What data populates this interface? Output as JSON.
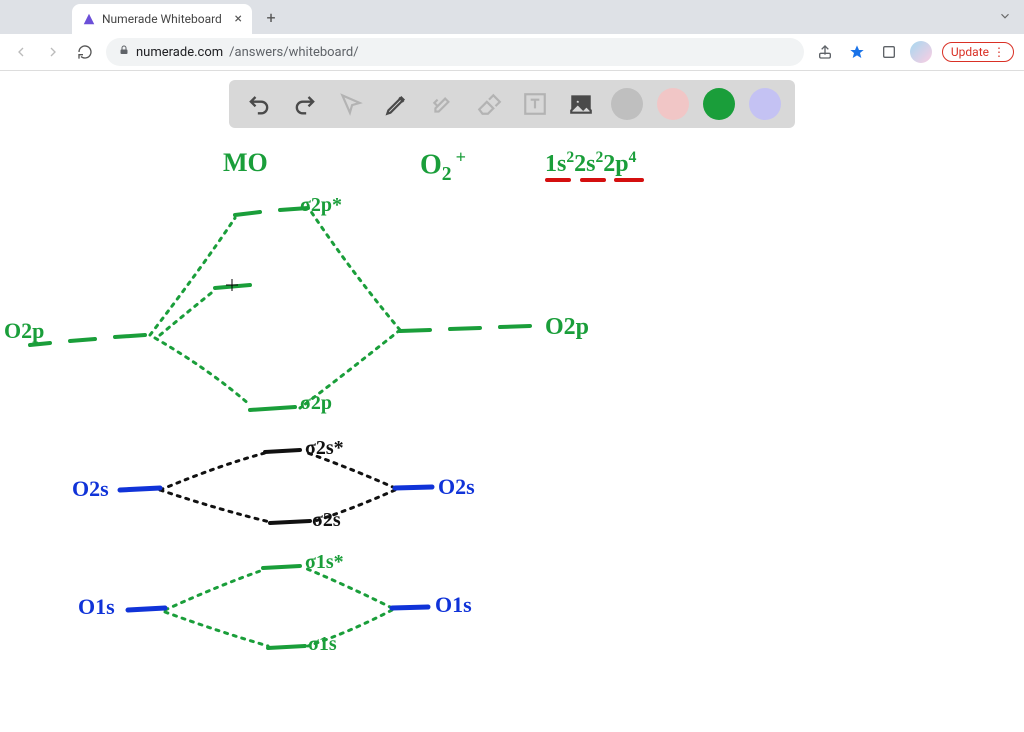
{
  "browser": {
    "tab_title": "Numerade Whiteboard",
    "url_host": "numerade.com",
    "url_path": "/answers/whiteboard/",
    "update_label": "Update"
  },
  "toolbar": {
    "colors": {
      "grey": "#bfbfbf",
      "pink": "#f1c6c6",
      "green": "#1a9e3a",
      "lavender": "#c4c2f3"
    }
  },
  "whiteboard": {
    "title_mo": "MO",
    "title_species_base": "O",
    "title_species_sub": "2",
    "title_species_sup": "+",
    "config_1s": "1s",
    "config_1s_sup": "2",
    "config_2s": "2s",
    "config_2s_sup": "2",
    "config_2p": "2p",
    "config_2p_sup": "4",
    "sigma2p_star": "σ2p*",
    "sigma2p": "σ2p",
    "sigma2s_star": "σ2s*",
    "sigma2s": "σ2s",
    "sigma1s_star": "σ1s*",
    "sigma1s": "σ1s",
    "left_O2p": "O2p",
    "right_O2p": "O2p",
    "left_O2s": "O2s",
    "right_O2s": "O2s",
    "left_O1s": "O1s",
    "right_O1s": "O1s"
  }
}
